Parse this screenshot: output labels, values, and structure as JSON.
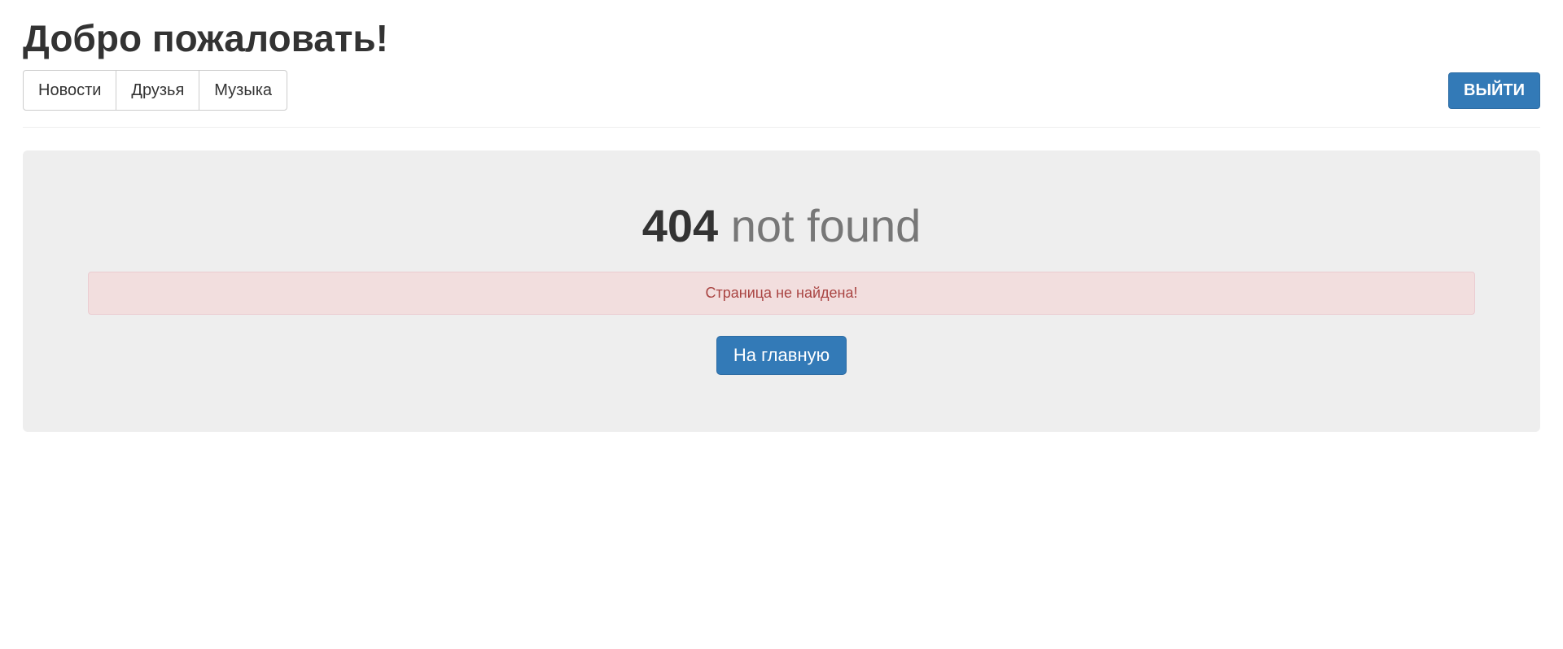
{
  "header": {
    "title": "Добро пожаловать!"
  },
  "nav": {
    "items": [
      {
        "label": "Новости"
      },
      {
        "label": "Друзья"
      },
      {
        "label": "Музыка"
      }
    ],
    "logout_label": "ВЫЙТИ"
  },
  "error": {
    "code": "404",
    "suffix": " not found",
    "message": "Страница не найдена!",
    "home_label": "На главную"
  }
}
